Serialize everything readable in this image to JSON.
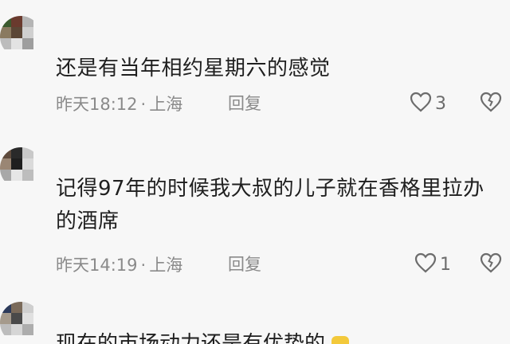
{
  "comments": [
    {
      "text": "还是有当年相约星期六的感觉",
      "time": "昨天18:12",
      "dot": "·",
      "location": "上海",
      "reply_label": "回复",
      "likes": "3"
    },
    {
      "text": "记得97年的时候我大叔的儿子就在香格里拉办的酒席",
      "time": "昨天14:19",
      "dot": "·",
      "location": "上海",
      "reply_label": "回复",
      "likes": "1"
    },
    {
      "text": "现在的市场动力还是有优势的"
    }
  ],
  "icons": {
    "like": "heart-outline-icon",
    "dislike": "broken-heart-icon"
  },
  "colors": {
    "background": "#f7f7f7",
    "text": "#1f1f1f",
    "meta": "#8a8a8a"
  }
}
